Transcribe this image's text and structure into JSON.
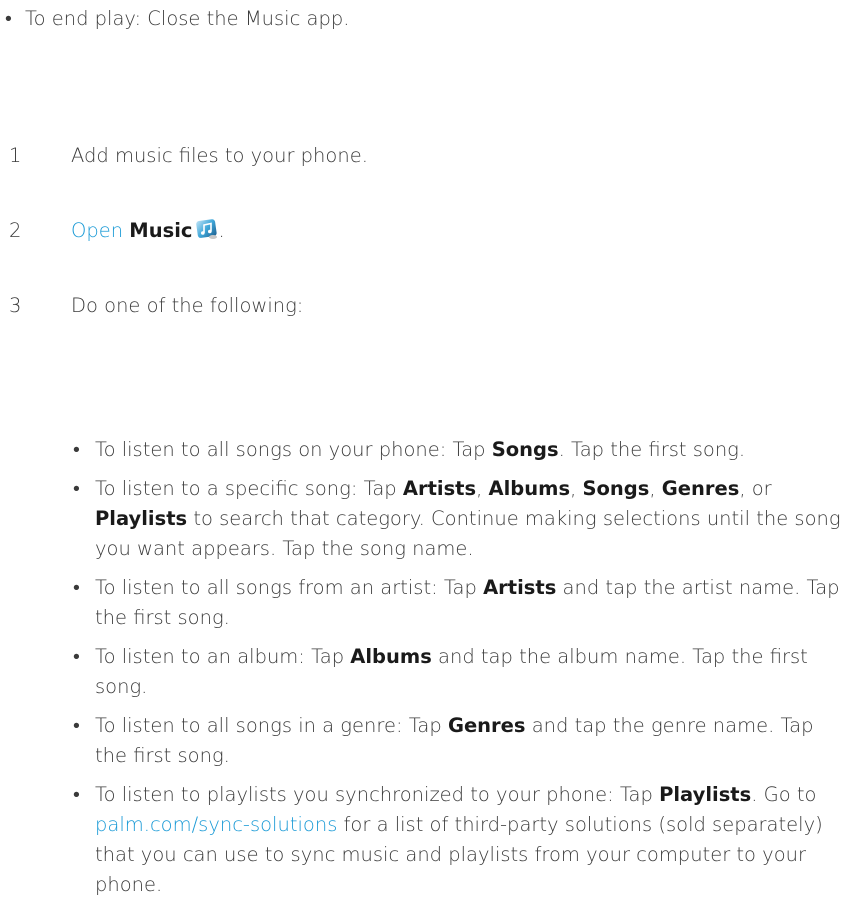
{
  "top_bullet": {
    "marker": "•",
    "text": "To end play: Close the Music app."
  },
  "steps": [
    {
      "number": "1",
      "text": "Add music files to your phone."
    },
    {
      "number": "2",
      "link": "Open",
      "bold": "Music",
      "icon": "music-app-icon",
      "suffix": "."
    },
    {
      "number": "3",
      "text": "Do one of the following:"
    }
  ],
  "sub_items": [
    {
      "p1": "To listen to all songs on your phone: Tap ",
      "b1": "Songs",
      "p2": ". Tap the first song."
    },
    {
      "p1": "To listen to a specific song: Tap ",
      "b1": "Artists",
      "p2": ", ",
      "b2": "Albums",
      "p3": ", ",
      "b3": "Songs",
      "p4": ", ",
      "b4": "Genres",
      "p5": ", or ",
      "b5": "Playlists",
      "p6": " to search that category. Continue making selections until the song you want appears. Tap the song name."
    },
    {
      "p1": "To listen to all songs from an artist: Tap ",
      "b1": "Artists",
      "p2": " and tap the artist name. Tap the first song."
    },
    {
      "p1": "To listen to an album: Tap ",
      "b1": "Albums",
      "p2": " and tap the album name. Tap the first song."
    },
    {
      "p1": "To listen to all songs in a genre: Tap ",
      "b1": "Genres",
      "p2": " and tap the genre name. Tap the first song."
    },
    {
      "p1": "To listen to playlists you synchronized to your phone: Tap ",
      "b1": "Playlists",
      "p2": ". Go to ",
      "link": "palm.com/sync-solutions",
      "p3": " for a list of third-party solutions (sold separately) that you can use to sync music and playlists from your computer to your phone."
    }
  ],
  "colors": {
    "text": "#3a3a3a",
    "bold": "#1a1a1a",
    "link": "#1a9ad6"
  }
}
